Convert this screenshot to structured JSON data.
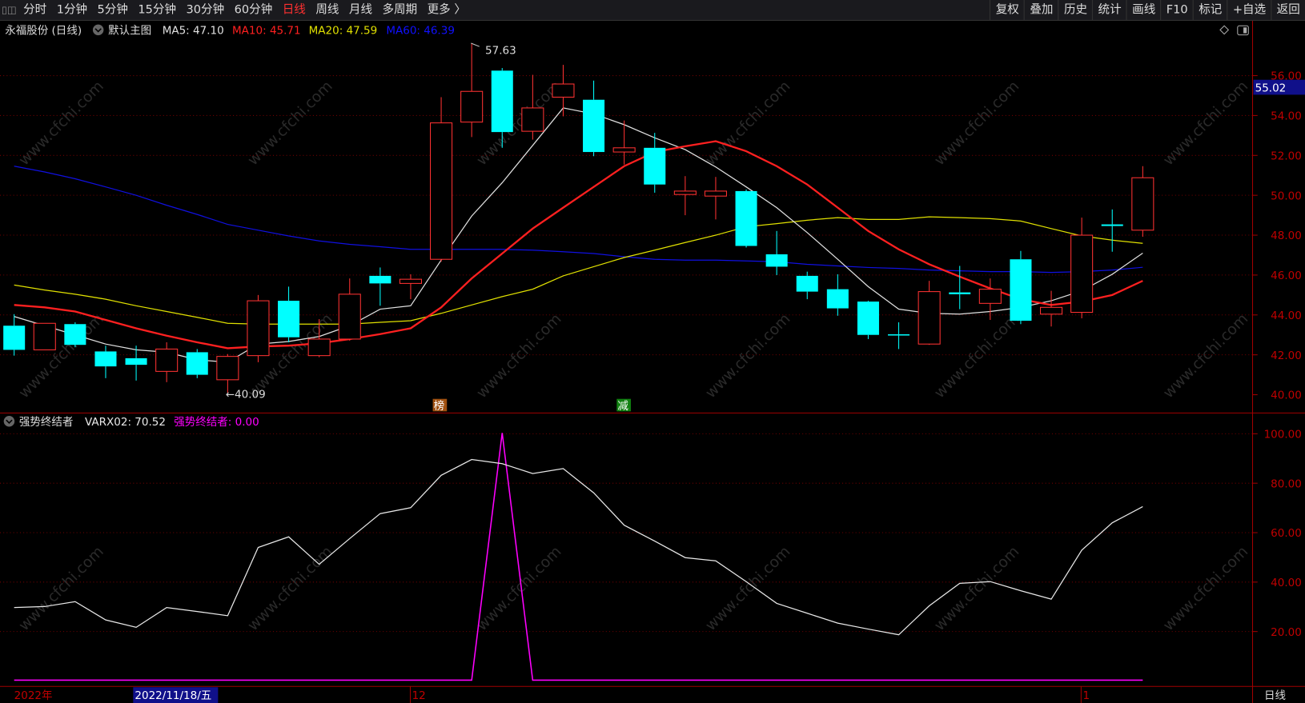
{
  "toolbar": {
    "periods": [
      "分时",
      "1分钟",
      "5分钟",
      "15分钟",
      "30分钟",
      "60分钟",
      "日线",
      "周线",
      "月线",
      "多周期",
      "更多 〉"
    ],
    "active_period": "日线",
    "actions": [
      "复权",
      "叠加",
      "历史",
      "统计",
      "画线",
      "F10",
      "标记",
      "+自选",
      "返回"
    ]
  },
  "main_panel": {
    "title": "永福股份 (日线)",
    "template": "默认主图",
    "ma5": "MA5: 47.10",
    "ma10": "MA10: 45.71",
    "ma20": "MA20: 47.59",
    "ma60": "MA60: 46.39",
    "current_price": "55.02",
    "high_label": "57.63",
    "low_label": "←40.09",
    "marker_1": "榜",
    "marker_2": "减",
    "price_ticks": [
      "56.00",
      "54.00",
      "52.00",
      "50.00",
      "48.00",
      "46.00",
      "44.00",
      "42.00",
      "40.00"
    ]
  },
  "indicator_panel": {
    "name": "强势终结者",
    "varx02": "VARX02: 70.52",
    "signal": "强势终结者: 0.00",
    "ticks": [
      "100.00",
      "80.00",
      "60.00",
      "40.00",
      "20.00"
    ]
  },
  "time_axis": {
    "year": "2022年",
    "cursor_date": "2022/11/18/五",
    "month_dec": "12",
    "month_jan": "1",
    "period": "日线"
  },
  "watermark": "www.cfchi.com",
  "colors": {
    "up": "#ff3232",
    "down": "#00ffff",
    "ma5": "#e0e0e0",
    "ma10": "#ff2020",
    "ma20": "#e0e000",
    "ma60": "#1010e0",
    "varx": "#e8e8e8",
    "signal": "#ff00ff"
  },
  "chart_data": {
    "type": "candlestick",
    "price_range": [
      40,
      56
    ],
    "candles_ohlc": [
      [
        43.46,
        44.04,
        41.96,
        42.25
      ],
      [
        42.25,
        43.58,
        42.25,
        43.58
      ],
      [
        43.54,
        43.63,
        42.38,
        42.5
      ],
      [
        42.17,
        42.46,
        40.83,
        41.42
      ],
      [
        41.83,
        42.46,
        40.71,
        41.5
      ],
      [
        41.17,
        42.63,
        40.63,
        42.29
      ],
      [
        42.13,
        42.29,
        40.83,
        41.0
      ],
      [
        40.75,
        42.04,
        40.09,
        41.92
      ],
      [
        41.96,
        45.0,
        41.63,
        44.71
      ],
      [
        44.71,
        45.42,
        42.63,
        42.88
      ],
      [
        41.96,
        43.79,
        41.88,
        42.79
      ],
      [
        42.79,
        45.83,
        42.71,
        45.04
      ],
      [
        45.96,
        46.38,
        44.46,
        45.58
      ],
      [
        45.58,
        46.04,
        44.79,
        45.79
      ],
      [
        46.79,
        54.92,
        46.67,
        53.63
      ],
      [
        53.67,
        57.63,
        52.92,
        55.21
      ],
      [
        56.25,
        56.38,
        52.38,
        53.17
      ],
      [
        53.21,
        56.04,
        52.79,
        54.38
      ],
      [
        54.92,
        56.54,
        53.96,
        55.58
      ],
      [
        54.79,
        55.75,
        51.96,
        52.17
      ],
      [
        52.17,
        53.75,
        51.54,
        52.38
      ],
      [
        52.38,
        53.13,
        50.13,
        50.54
      ],
      [
        50.04,
        50.96,
        49.0,
        50.21
      ],
      [
        49.96,
        50.92,
        48.79,
        50.21
      ],
      [
        50.21,
        50.29,
        47.38,
        47.46
      ],
      [
        47.04,
        48.21,
        46.0,
        46.42
      ],
      [
        45.96,
        46.17,
        44.79,
        45.17
      ],
      [
        45.29,
        46.04,
        43.96,
        44.33
      ],
      [
        44.67,
        44.71,
        42.79,
        43.0
      ],
      [
        43.0,
        43.63,
        42.29,
        43.0
      ],
      [
        42.54,
        45.71,
        42.5,
        45.17
      ],
      [
        45.13,
        46.46,
        44.29,
        45.04
      ],
      [
        44.58,
        45.83,
        43.75,
        45.29
      ],
      [
        46.79,
        47.21,
        43.54,
        43.71
      ],
      [
        44.04,
        45.21,
        43.42,
        44.38
      ],
      [
        44.13,
        48.88,
        43.83,
        48.0
      ],
      [
        48.54,
        49.29,
        47.17,
        48.46
      ],
      [
        48.25,
        51.46,
        47.92,
        50.88
      ]
    ],
    "ma5": [
      43.92,
      43.46,
      43.0,
      42.54,
      42.25,
      42.13,
      41.75,
      41.63,
      42.54,
      42.67,
      42.92,
      43.46,
      44.29,
      44.46,
      46.75,
      48.96,
      50.63,
      52.5,
      54.38,
      54.08,
      53.54,
      52.88,
      52.29,
      51.42,
      50.42,
      49.38,
      48.13,
      46.79,
      45.42,
      44.29,
      44.08,
      44.04,
      44.17,
      44.38,
      44.71,
      45.21,
      46.04,
      47.1
    ],
    "ma10": [
      44.5,
      44.38,
      44.17,
      43.75,
      43.33,
      42.96,
      42.63,
      42.33,
      42.42,
      42.46,
      42.58,
      42.79,
      43.04,
      43.33,
      44.38,
      45.83,
      47.08,
      48.33,
      49.38,
      50.42,
      51.46,
      52.17,
      52.46,
      52.71,
      52.21,
      51.46,
      50.54,
      49.38,
      48.21,
      47.29,
      46.54,
      45.92,
      45.33,
      44.79,
      44.5,
      44.67,
      45.0,
      45.71
    ],
    "ma20": [
      45.5,
      45.25,
      45.04,
      44.79,
      44.46,
      44.17,
      43.88,
      43.58,
      43.54,
      43.54,
      43.54,
      43.54,
      43.63,
      43.71,
      44.08,
      44.5,
      44.92,
      45.29,
      45.96,
      46.42,
      46.88,
      47.25,
      47.63,
      48.0,
      48.42,
      48.58,
      48.75,
      48.88,
      48.79,
      48.79,
      48.92,
      48.88,
      48.83,
      48.71,
      48.33,
      47.96,
      47.75,
      47.59
    ],
    "ma60": [
      51.46,
      51.17,
      50.83,
      50.42,
      50.0,
      49.5,
      49.04,
      48.54,
      48.25,
      47.96,
      47.71,
      47.54,
      47.42,
      47.29,
      47.29,
      47.29,
      47.29,
      47.25,
      47.17,
      47.08,
      46.92,
      46.79,
      46.75,
      46.75,
      46.71,
      46.67,
      46.54,
      46.46,
      46.38,
      46.33,
      46.25,
      46.21,
      46.17,
      46.17,
      46.13,
      46.17,
      46.25,
      46.39
    ],
    "indicator_range": [
      0,
      100
    ],
    "varx02": [
      29.7,
      30.1,
      32.1,
      24.7,
      21.7,
      29.7,
      28.1,
      26.4,
      54.0,
      58.3,
      47.2,
      57.6,
      67.7,
      70.1,
      83.2,
      89.6,
      87.9,
      83.9,
      85.9,
      76.1,
      63.0,
      56.6,
      49.9,
      48.6,
      40.2,
      31.4,
      27.4,
      23.4,
      21.0,
      18.7,
      30.4,
      39.5,
      40.2,
      36.5,
      33.1,
      52.9,
      64.0,
      70.52
    ],
    "signal": [
      0,
      0,
      0,
      0,
      0,
      0,
      0,
      0,
      0,
      0,
      0,
      0,
      0,
      0,
      0,
      0,
      100,
      0,
      0,
      0,
      0,
      0,
      0,
      0,
      0,
      0,
      0,
      0,
      0,
      0,
      0,
      0,
      0,
      0,
      0,
      0,
      0,
      0
    ]
  }
}
